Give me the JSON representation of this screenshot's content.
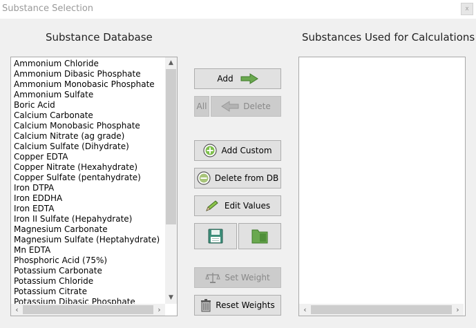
{
  "window": {
    "title": "Substance Selection",
    "close_glyph": "x"
  },
  "headings": {
    "database": "Substance Database",
    "used": "Substances Used for Calculations"
  },
  "database_list": [
    "Ammonium Chloride",
    "Ammonium Dibasic Phosphate",
    "Ammonium Monobasic Phosphate",
    "Ammonium Sulfate",
    "Boric Acid",
    "Calcium Carbonate",
    "Calcium Monobasic Phosphate",
    "Calcium Nitrate (ag grade)",
    "Calcium Sulfate (Dihydrate)",
    "Copper EDTA",
    "Copper Nitrate (Hexahydrate)",
    "Copper Sulfate (pentahydrate)",
    "Iron DTPA",
    "Iron EDDHA",
    "Iron EDTA",
    "Iron II Sulfate (Hepahydrate)",
    "Magnesium Carbonate",
    "Magnesium Sulfate (Heptahydrate)",
    "Mn EDTA",
    "Phosphoric Acid (75%)",
    "Potassium Carbonate",
    "Potassium Chloride",
    "Potassium Citrate",
    "Potassium Dibasic Phosphate"
  ],
  "buttons": {
    "add": "Add",
    "all": "All",
    "delete": "Delete",
    "add_custom": "Add Custom",
    "delete_from_db": "Delete from DB",
    "edit_values": "Edit Values",
    "set_weight": "Set Weight",
    "reset_weights": "Reset Weights"
  },
  "icons": {
    "add": "arrow-right-icon",
    "delete": "arrow-left-icon",
    "add_custom": "plus-circle-icon",
    "delete_from_db": "minus-circle-icon",
    "edit_values": "pencil-icon",
    "save": "floppy-disk-icon",
    "open": "folder-icon",
    "set_weight": "scale-icon",
    "reset_weights": "trash-icon"
  },
  "colors": {
    "accent_green": "#6aa84f",
    "disabled_bg": "#cccccc"
  }
}
